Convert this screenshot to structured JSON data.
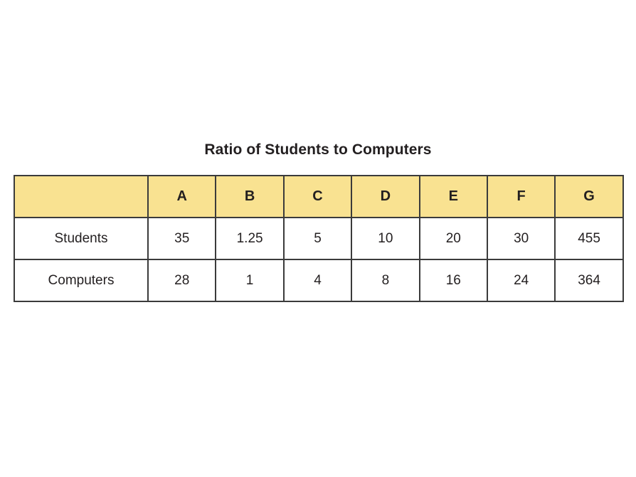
{
  "title": "Ratio of Students to Computers",
  "colors": {
    "header_fill": "#f9e291",
    "label_fill": "#f9e291",
    "cell_fill": "#ffffff",
    "border": "#3b3b3b",
    "text": "#231f20",
    "background": "#ffffff"
  },
  "table": {
    "corner_label": "",
    "column_headers": [
      "A",
      "B",
      "C",
      "D",
      "E",
      "F",
      "G"
    ],
    "rows": [
      {
        "label": "Students",
        "values": [
          "35",
          "1.25",
          "5",
          "10",
          "20",
          "30",
          "455"
        ]
      },
      {
        "label": "Computers",
        "values": [
          "28",
          "1",
          "4",
          "8",
          "16",
          "24",
          "364"
        ]
      }
    ]
  },
  "chart_data": {
    "type": "table",
    "title": "Ratio of Students to Computers",
    "categories": [
      "A",
      "B",
      "C",
      "D",
      "E",
      "F",
      "G"
    ],
    "series": [
      {
        "name": "Students",
        "values": [
          35,
          1.25,
          5,
          10,
          20,
          30,
          455
        ]
      },
      {
        "name": "Computers",
        "values": [
          28,
          1,
          4,
          8,
          16,
          24,
          364
        ]
      }
    ],
    "xlabel": "",
    "ylabel": "",
    "legend": "none",
    "grid": true
  }
}
